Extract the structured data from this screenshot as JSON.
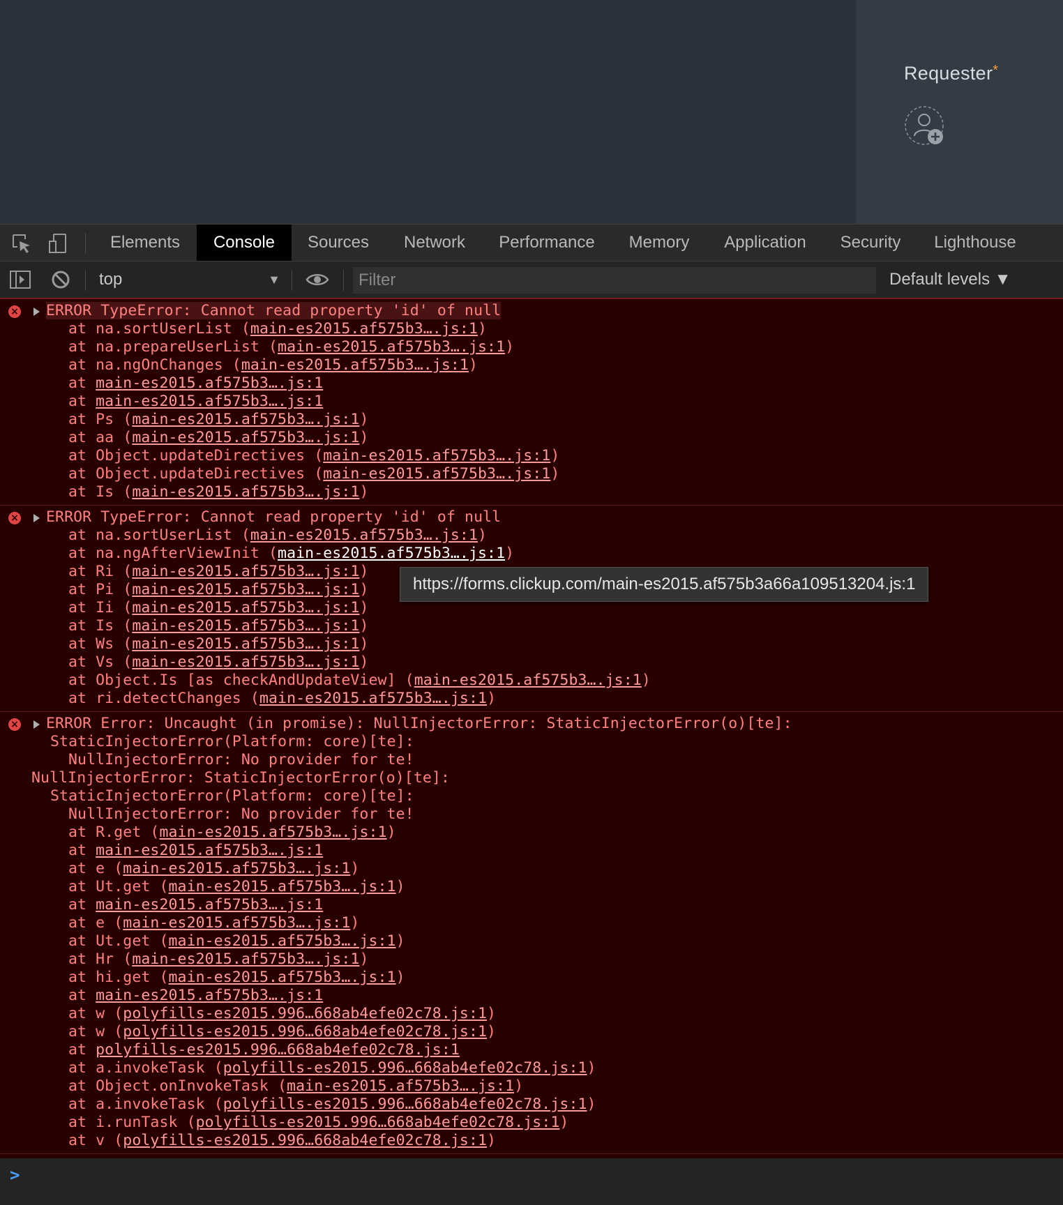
{
  "form": {
    "requester_label": "Requester",
    "required_mark": "*"
  },
  "devtools": {
    "tabs": [
      "Elements",
      "Console",
      "Sources",
      "Network",
      "Performance",
      "Memory",
      "Application",
      "Security",
      "Lighthouse"
    ],
    "active_tab": "Console",
    "context": "top",
    "filter_placeholder": "Filter",
    "levels_label": "Default levels ▼"
  },
  "tooltip": "https://forms.clickup.com/main-es2015.af575b3a66a109513204.js:1",
  "messages": [
    {
      "head": "ERROR TypeError: Cannot read property 'id' of null",
      "frames": [
        {
          "fn": "na.sortUserList",
          "src": "main-es2015.af575b3….js:1"
        },
        {
          "fn": "na.prepareUserList",
          "src": "main-es2015.af575b3….js:1"
        },
        {
          "fn": "na.ngOnChanges",
          "src": "main-es2015.af575b3….js:1"
        },
        {
          "fn": "",
          "src": "main-es2015.af575b3….js:1"
        },
        {
          "fn": "",
          "src": "main-es2015.af575b3….js:1"
        },
        {
          "fn": "Ps",
          "src": "main-es2015.af575b3….js:1"
        },
        {
          "fn": "aa",
          "src": "main-es2015.af575b3….js:1"
        },
        {
          "fn": "Object.updateDirectives",
          "src": "main-es2015.af575b3….js:1"
        },
        {
          "fn": "Object.updateDirectives",
          "src": "main-es2015.af575b3….js:1"
        },
        {
          "fn": "Is",
          "src": "main-es2015.af575b3….js:1"
        }
      ]
    },
    {
      "head": "ERROR TypeError: Cannot read property 'id' of null",
      "frames": [
        {
          "fn": "na.sortUserList",
          "src": "main-es2015.af575b3….js:1"
        },
        {
          "fn": "na.ngAfterViewInit",
          "src": "main-es2015.af575b3….js:1"
        },
        {
          "fn": "Ri",
          "src": "main-es2015.af575b3….js:1"
        },
        {
          "fn": "Pi",
          "src": "main-es2015.af575b3….js:1"
        },
        {
          "fn": "Ii",
          "src": "main-es2015.af575b3….js:1"
        },
        {
          "fn": "Is",
          "src": "main-es2015.af575b3….js:1"
        },
        {
          "fn": "Ws",
          "src": "main-es2015.af575b3….js:1"
        },
        {
          "fn": "Vs",
          "src": "main-es2015.af575b3….js:1"
        },
        {
          "fn": "Object.Is [as checkAndUpdateView]",
          "src": "main-es2015.af575b3….js:1"
        },
        {
          "fn": "ri.detectChanges",
          "src": "main-es2015.af575b3….js:1"
        }
      ]
    },
    {
      "head": "ERROR Error: Uncaught (in promise): NullInjectorError: StaticInjectorError(o)[te]:",
      "pre": [
        {
          "indent": "sub1",
          "text": "StaticInjectorError(Platform: core)[te]:"
        },
        {
          "indent": "sub2",
          "text": "NullInjectorError: No provider for te!"
        },
        {
          "indent": "sub0",
          "text": "NullInjectorError: StaticInjectorError(o)[te]:"
        },
        {
          "indent": "sub1",
          "text": "StaticInjectorError(Platform: core)[te]:"
        },
        {
          "indent": "sub2",
          "text": "NullInjectorError: No provider for te!"
        }
      ],
      "frames": [
        {
          "fn": "R.get",
          "src": "main-es2015.af575b3….js:1"
        },
        {
          "fn": "",
          "src": "main-es2015.af575b3….js:1"
        },
        {
          "fn": "e",
          "src": "main-es2015.af575b3….js:1"
        },
        {
          "fn": "Ut.get",
          "src": "main-es2015.af575b3….js:1"
        },
        {
          "fn": "",
          "src": "main-es2015.af575b3….js:1"
        },
        {
          "fn": "e",
          "src": "main-es2015.af575b3….js:1"
        },
        {
          "fn": "Ut.get",
          "src": "main-es2015.af575b3….js:1"
        },
        {
          "fn": "Hr",
          "src": "main-es2015.af575b3….js:1"
        },
        {
          "fn": "hi.get",
          "src": "main-es2015.af575b3….js:1"
        },
        {
          "fn": "",
          "src": "main-es2015.af575b3….js:1"
        },
        {
          "fn": "w",
          "src": "polyfills-es2015.996…668ab4efe02c78.js:1"
        },
        {
          "fn": "w",
          "src": "polyfills-es2015.996…668ab4efe02c78.js:1"
        },
        {
          "fn": "",
          "src": "polyfills-es2015.996…668ab4efe02c78.js:1"
        },
        {
          "fn": "a.invokeTask",
          "src": "polyfills-es2015.996…668ab4efe02c78.js:1"
        },
        {
          "fn": "Object.onInvokeTask",
          "src": "main-es2015.af575b3….js:1"
        },
        {
          "fn": "a.invokeTask",
          "src": "polyfills-es2015.996…668ab4efe02c78.js:1"
        },
        {
          "fn": "i.runTask",
          "src": "polyfills-es2015.996…668ab4efe02c78.js:1"
        },
        {
          "fn": "v",
          "src": "polyfills-es2015.996…668ab4efe02c78.js:1"
        }
      ]
    }
  ],
  "colors": {
    "page_bg": "#2a333c",
    "console_error_bg": "#290000",
    "error_text": "#ff8080",
    "required_star": "#f0a23b",
    "prompt": "#4a9cf6"
  }
}
